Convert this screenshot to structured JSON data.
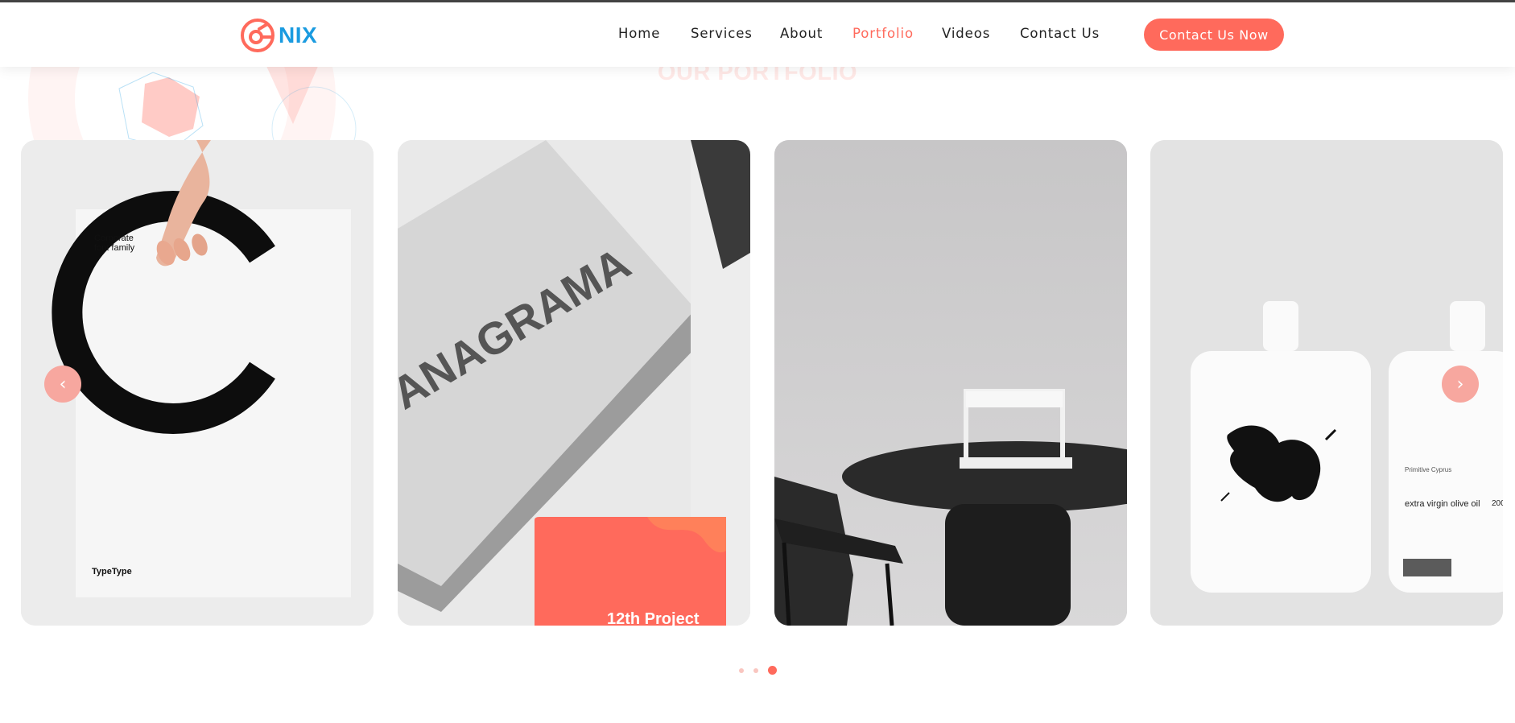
{
  "brand": {
    "name": "NIX",
    "accent_color": "#ff6a5c",
    "logo_text_color": "#1a9be0"
  },
  "nav": {
    "items": [
      {
        "label": "Home",
        "active": false
      },
      {
        "label": "Services",
        "active": false
      },
      {
        "label": "About",
        "active": false
      },
      {
        "label": "Portfolio",
        "active": true
      },
      {
        "label": "Videos",
        "active": false
      },
      {
        "label": "Contact Us",
        "active": false
      }
    ],
    "cta_label": "Contact Us Now"
  },
  "section": {
    "title": "OUR PORTFOLIO"
  },
  "portfolio": {
    "cards": [
      {
        "subject": "corporate-font-poster",
        "texts": [
          "Corporate",
          "font family",
          "C",
          "TypeType"
        ]
      },
      {
        "subject": "anagrama-business-cards",
        "texts": [
          "ANAGRAMA",
          "12th Project"
        ]
      },
      {
        "subject": "table-lamp-interior",
        "texts": []
      },
      {
        "subject": "olive-oil-bottles",
        "texts": [
          "Primitive Cyprus",
          "extra virgin olive oil",
          "200"
        ]
      }
    ]
  },
  "carousel": {
    "prev_icon": "chevron-left-icon",
    "next_icon": "chevron-right-icon",
    "prev_glyph": "‹",
    "next_glyph": "›",
    "pages": 3,
    "active_page": 3
  }
}
